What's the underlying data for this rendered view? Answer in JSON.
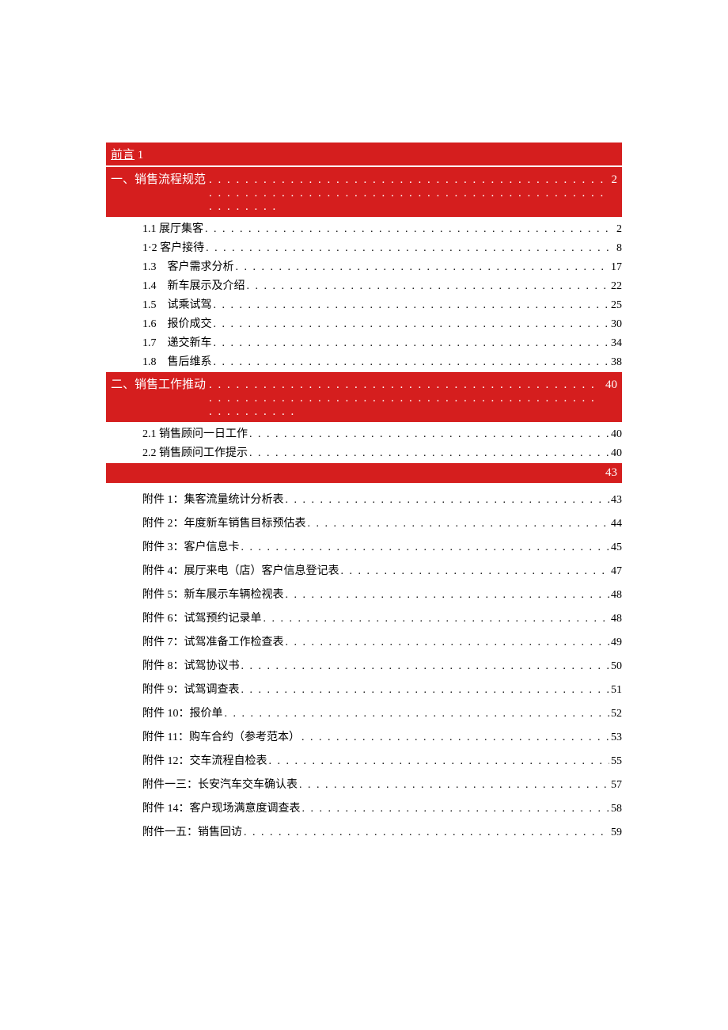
{
  "dots": ". . . . . . . . . . . . . . . . . . . . . . . . . . . . . . . . . . . . . . . . . . . . . . . . . . . . . . . . . . . . . . . . . . . . . . . . . . . . . . . . . . . . . . . . . . . . . . . .",
  "preface": {
    "label": "前言",
    "page": "1"
  },
  "section1": {
    "label": "一、销售流程规范",
    "page": "2"
  },
  "sec1_items": [
    {
      "label": "1.1 展厅集客",
      "page": "2"
    },
    {
      "label": "1·2 客户接待",
      "page": "8"
    },
    {
      "label": "1.3 客户需求分析",
      "page": "17"
    },
    {
      "label": "1.4 新车展示及介绍",
      "page": "22"
    },
    {
      "label": "1.5 试乘试驾",
      "page": "25"
    },
    {
      "label": "1.6 报价成交",
      "page": "30"
    },
    {
      "label": "1.7 递交新车",
      "page": "34"
    },
    {
      "label": "1.8 售后维系",
      "page": "38"
    }
  ],
  "section2": {
    "label": "二、销售工作推动",
    "page": "40"
  },
  "sec2_items": [
    {
      "label": "2.1 销售顾问一日工作",
      "page": "40"
    },
    {
      "label": "2.2 销售顾问工作提示",
      "page": "40"
    }
  ],
  "attachments_header": {
    "page": "43"
  },
  "attachments": [
    {
      "label": "附件 1：集客流量统计分析表",
      "page": "43"
    },
    {
      "label": "附件 2：年度新车销售目标预估表",
      "page": "44"
    },
    {
      "label": "附件 3：客户信息卡",
      "page": "45"
    },
    {
      "label": "附件 4：展厅来电（店）客户信息登记表",
      "page": "47"
    },
    {
      "label": "附件 5：新车展示车辆检视表",
      "page": "48"
    },
    {
      "label": "附件 6：试驾预约记录单",
      "page": "48"
    },
    {
      "label": "附件 7：试驾准备工作检查表",
      "page": "49"
    },
    {
      "label": "附件 8：试驾协议书",
      "page": "50"
    },
    {
      "label": "附件 9：试驾调查表",
      "page": "51"
    },
    {
      "label": "附件 10：报价单",
      "page": "52"
    },
    {
      "label": "附件 11：购车合约（参考范本）",
      "page": "53"
    },
    {
      "label": "附件 12：交车流程自检表",
      "page": "55"
    },
    {
      "label": "附件一三：长安汽车交车确认表",
      "page": "57"
    },
    {
      "label": "附件 14：客户现场满意度调查表",
      "page": "58"
    },
    {
      "label": "附件一五：销售回访",
      "page": "59"
    }
  ]
}
